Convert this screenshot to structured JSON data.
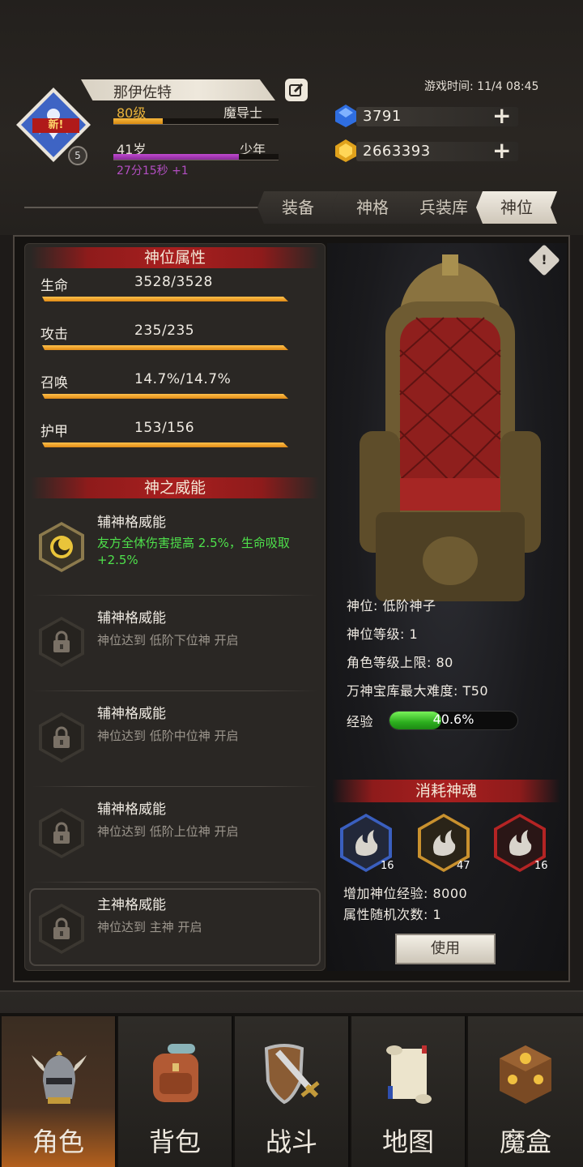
{
  "header": {
    "avatar_badge": "新!",
    "avatar_level": "5",
    "player_name": "那伊佐特",
    "level_text": "80级",
    "class_text": "魔导士",
    "level_progress": 0.3,
    "age_text": "41岁",
    "age_stage": "少年",
    "age_progress": 0.76,
    "age_timer": "27分15秒 +1",
    "game_time": "游戏时间: 11/4 08:45"
  },
  "resources": [
    {
      "icon": "blue-gem-icon",
      "value": "3791"
    },
    {
      "icon": "gold-coin-icon",
      "value": "2663393"
    }
  ],
  "tabs": [
    {
      "label": "装备",
      "active": false
    },
    {
      "label": "神格",
      "active": false
    },
    {
      "label": "兵装库",
      "active": false
    },
    {
      "label": "神位",
      "active": true
    }
  ],
  "attributes": {
    "title": "神位属性",
    "items": [
      {
        "label": "生命",
        "value": "3528/3528"
      },
      {
        "label": "攻击",
        "value": "235/235"
      },
      {
        "label": "召唤",
        "value": "14.7%/14.7%"
      },
      {
        "label": "护甲",
        "value": "153/156"
      }
    ]
  },
  "powers": {
    "title": "神之威能",
    "items": [
      {
        "title": "辅神格威能",
        "desc": "友方全体伤害提高 2.5%，生命吸取+2.5%",
        "unlocked": true
      },
      {
        "title": "辅神格威能",
        "desc": "神位达到 低阶下位神 开启",
        "unlocked": false
      },
      {
        "title": "辅神格威能",
        "desc": "神位达到 低阶中位神 开启",
        "unlocked": false
      },
      {
        "title": "辅神格威能",
        "desc": "神位达到 低阶上位神 开启",
        "unlocked": false
      },
      {
        "title": "主神格威能",
        "desc": "神位达到 主神 开启",
        "unlocked": false
      }
    ]
  },
  "god_info": {
    "rank": "神位: 低阶神子",
    "rank_level": "神位等级: 1",
    "level_cap": "角色等级上限: 80",
    "vault_difficulty": "万神宝库最大难度: T50",
    "exp_label": "经验",
    "exp_percent": 0.406,
    "exp_text": "40.6%"
  },
  "consume": {
    "title": "消耗神魂",
    "souls": [
      {
        "count": "16",
        "color": "#3a5fbf"
      },
      {
        "count": "47",
        "color": "#c9912e"
      },
      {
        "count": "16",
        "color": "#b42424"
      }
    ],
    "exp_gain": "增加神位经验: 8000",
    "reroll": "属性随机次数: 1",
    "use_label": "使用"
  },
  "nav": [
    {
      "label": "角色",
      "icon": "helmet-icon",
      "active": true
    },
    {
      "label": "背包",
      "icon": "backpack-icon",
      "active": false
    },
    {
      "label": "战斗",
      "icon": "sword-shield-icon",
      "active": false
    },
    {
      "label": "地图",
      "icon": "scroll-map-icon",
      "active": false
    },
    {
      "label": "魔盒",
      "icon": "magic-box-icon",
      "active": false
    }
  ]
}
